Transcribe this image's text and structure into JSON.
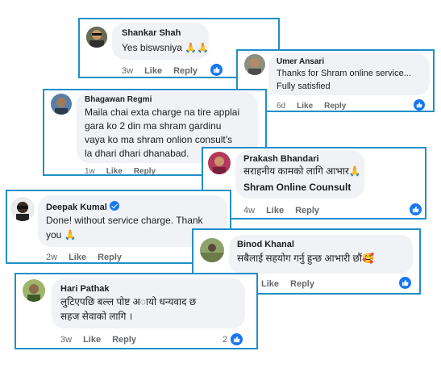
{
  "comments": [
    {
      "name": "Shankar Shah",
      "lines": [
        "Yes biswsniya 🙏🙏"
      ],
      "time": "3w",
      "like": "Like",
      "reply": "Reply"
    },
    {
      "name": "Umer Ansari",
      "lines": [
        "Thanks for Shram online service...",
        "Fully satisfied"
      ],
      "time": "6d",
      "like": "Like",
      "reply": "Reply"
    },
    {
      "name": "Bhagawan Regmi",
      "lines": [
        "Maila chai exta charge na tire applai",
        "gara ko 2 din ma shram gardinu",
        "vaya ko ma shram onlion consult's",
        "la dhari dhari dhanabad."
      ],
      "time": "1w",
      "like": "Like",
      "reply": "Reply"
    },
    {
      "name": "Prakash Bhandari",
      "lines": [
        "सराहनीय कामको लागि आभार🙏",
        "Shram Online Counsult"
      ],
      "time": "4w",
      "like": "Like",
      "reply": "Reply"
    },
    {
      "name": "Deepak Kumal",
      "lines": [
        "Done! without service charge. Thank",
        "you 🙏"
      ],
      "time": "2w",
      "like": "Like",
      "reply": "Reply"
    },
    {
      "name": "Binod Khanal",
      "lines": [
        "सबैलाई सहयोग गर्नु हुन्छ आभारी छौं🥰"
      ],
      "time": "",
      "like": "Like",
      "reply": "Reply"
    },
    {
      "name": "Hari Pathak",
      "lines": [
        "लुटिएपछि बल्ल पोष्ट अायो धन्यवाद छ",
        "सहज सेवाको लागि ।"
      ],
      "time": "3w",
      "like": "Like",
      "reply": "Reply",
      "reaction_count": "2"
    }
  ],
  "colors": {
    "frame": "#1f8fc9",
    "bubble": "#f0f2f5",
    "like_blue": "#1877f2"
  },
  "icons": {
    "reaction": "thumbs-up-icon",
    "verified": "verified-badge-icon"
  }
}
